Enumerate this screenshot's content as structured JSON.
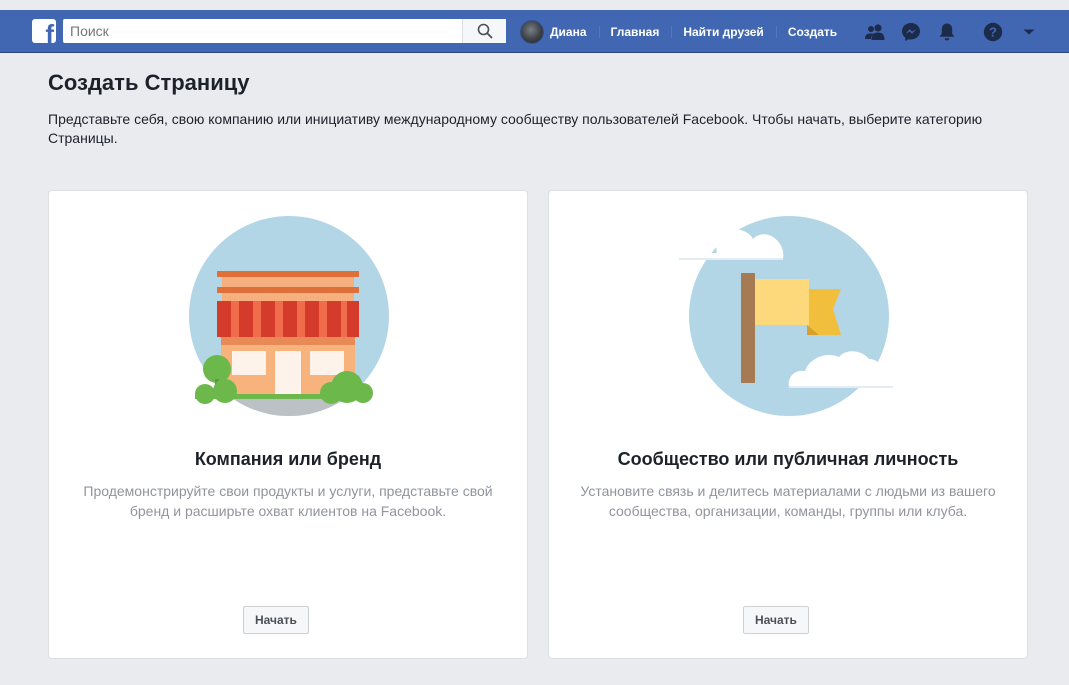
{
  "header": {
    "search_placeholder": "Поиск",
    "profile_name": "Диана",
    "nav": [
      "Главная",
      "Найти друзей",
      "Создать"
    ],
    "icons": [
      "friends-icon",
      "messenger-icon",
      "notifications-icon",
      "help-icon",
      "menu-caret-icon"
    ]
  },
  "page": {
    "title": "Создать Страницу",
    "intro": "Представьте себя, свою компанию или инициативу международному сообществу пользователей Facebook. Чтобы начать, выберите категорию Страницы."
  },
  "cards": [
    {
      "title": "Компания или бренд",
      "description": "Продемонстрируйте свои продукты и услуги, представьте свой бренд и расширьте охват клиентов на Facebook.",
      "button": "Начать",
      "illustration": "storefront-illustration"
    },
    {
      "title": "Сообщество или публичная личность",
      "description": "Установите связь и делитесь материалами с людьми из вашего сообщества, организации, команды, группы или клуба.",
      "button": "Начать",
      "illustration": "flag-illustration"
    }
  ],
  "colors": {
    "brand": "#4267b2",
    "background": "#e9ebee"
  }
}
